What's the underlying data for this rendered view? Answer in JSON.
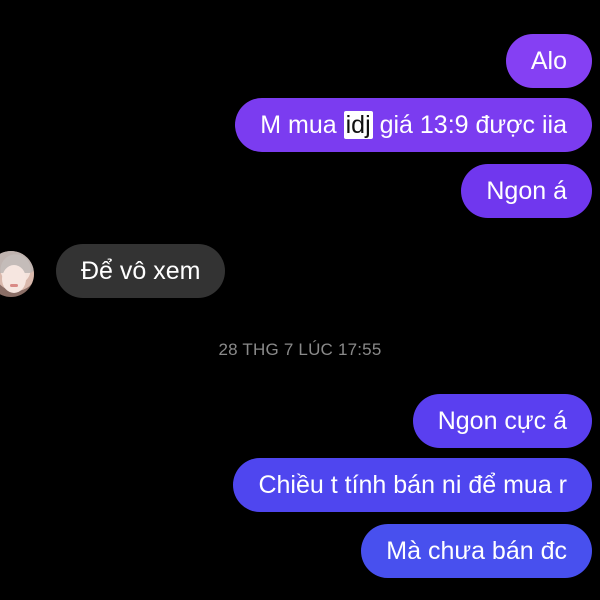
{
  "messages_before": [
    {
      "id": "m1",
      "text": "Alo",
      "color": "#8540f3"
    },
    {
      "id": "m2",
      "pre": "M mua ",
      "highlight": "idj",
      "post": " giá 13:9 được iia",
      "color": "#7b3cf0"
    },
    {
      "id": "m3",
      "text": "Ngon á",
      "color": "#7037ee"
    }
  ],
  "incoming": {
    "text": "Để vô xem",
    "avatar_icon": "contact-avatar"
  },
  "timestamp": "28 THG 7 LÚC 17:55",
  "messages_after": [
    {
      "id": "m5",
      "text": "Ngon cực á",
      "color": "#5a3ff0"
    },
    {
      "id": "m6",
      "text": "Chiều t tính bán ni để mua r",
      "color": "#4f46ef"
    },
    {
      "id": "m7",
      "text": "Mà chưa bán đc",
      "color": "#4850ee"
    }
  ]
}
